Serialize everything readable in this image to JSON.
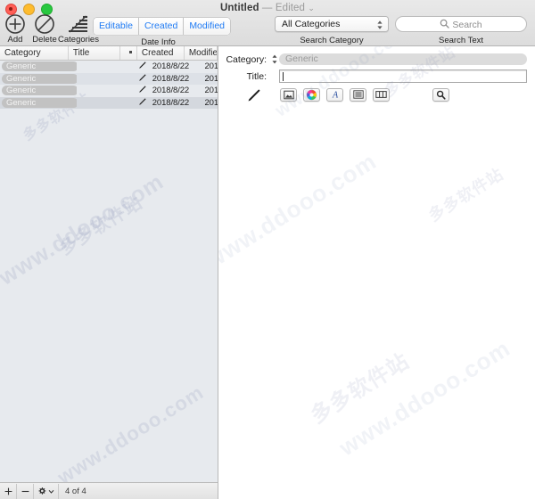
{
  "window": {
    "title": "Untitled",
    "separator": "—",
    "edited": "Edited",
    "chevron": "⌄"
  },
  "toolbar": {
    "add_label": "Add",
    "delete_label": "Delete",
    "categories_label": "Categories",
    "date_info": {
      "caption": "Date Info",
      "buttons": [
        "Editable",
        "Created",
        "Modified"
      ]
    },
    "search_category": {
      "caption": "Search Category",
      "value": "All Categories"
    },
    "search_text": {
      "caption": "Search Text",
      "placeholder": "Search"
    }
  },
  "list": {
    "columns": [
      "Category",
      "Title",
      "•",
      "Created",
      "Modified"
    ],
    "rows": [
      {
        "category": "Generic",
        "title": "",
        "created": "2018/8/22",
        "modified": "201"
      },
      {
        "category": "Generic",
        "title": "",
        "created": "2018/8/22",
        "modified": "201"
      },
      {
        "category": "Generic",
        "title": "",
        "created": "2018/8/22",
        "modified": "201"
      },
      {
        "category": "Generic",
        "title": "",
        "created": "2018/8/22",
        "modified": "201"
      }
    ]
  },
  "bottom_bar": {
    "add": "+",
    "remove": "−",
    "gear_chevron": "⌄",
    "count": "4 of 4"
  },
  "detail": {
    "category_label": "Category:",
    "category_value": "Generic",
    "title_label": "Title:",
    "title_value": "",
    "format_buttons": [
      "image-icon",
      "colors-icon",
      "fonts-icon",
      "text-list-icon",
      "table-icon",
      "search-icon"
    ]
  },
  "colors": {
    "accent_blue": "#1f7bf4",
    "pill_gray": "#c2c2c2",
    "list_bg": "#e7eaee",
    "row_alt": "#dde1e7"
  },
  "watermark": {
    "url": "www.ddooo.com",
    "cn": "多多软件站"
  }
}
